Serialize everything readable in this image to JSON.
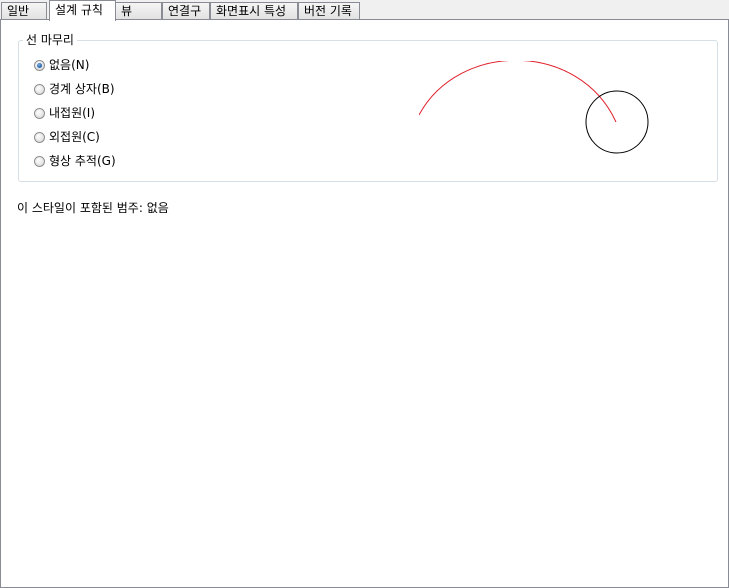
{
  "tabs": [
    {
      "label": "일반",
      "active": false
    },
    {
      "label": "설계 규칙",
      "active": true
    },
    {
      "label": "뷰",
      "active": false
    },
    {
      "label": "연결구",
      "active": false
    },
    {
      "label": "화면표시 특성",
      "active": false
    },
    {
      "label": "버전 기록",
      "active": false
    }
  ],
  "line_ending": {
    "title": "선 마무리",
    "options": [
      {
        "label": "없음(N)",
        "checked": true
      },
      {
        "label": "경계 상자(B)",
        "checked": false
      },
      {
        "label": "내접원(I)",
        "checked": false
      },
      {
        "label": "외접원(C)",
        "checked": false
      },
      {
        "label": "형상 추적(G)",
        "checked": false
      }
    ],
    "preview": {
      "arc_color": "#e0202a",
      "circle_color": "#000000"
    }
  },
  "category": {
    "label": "이 스타일이 포함된 범주:",
    "value": "없음"
  }
}
